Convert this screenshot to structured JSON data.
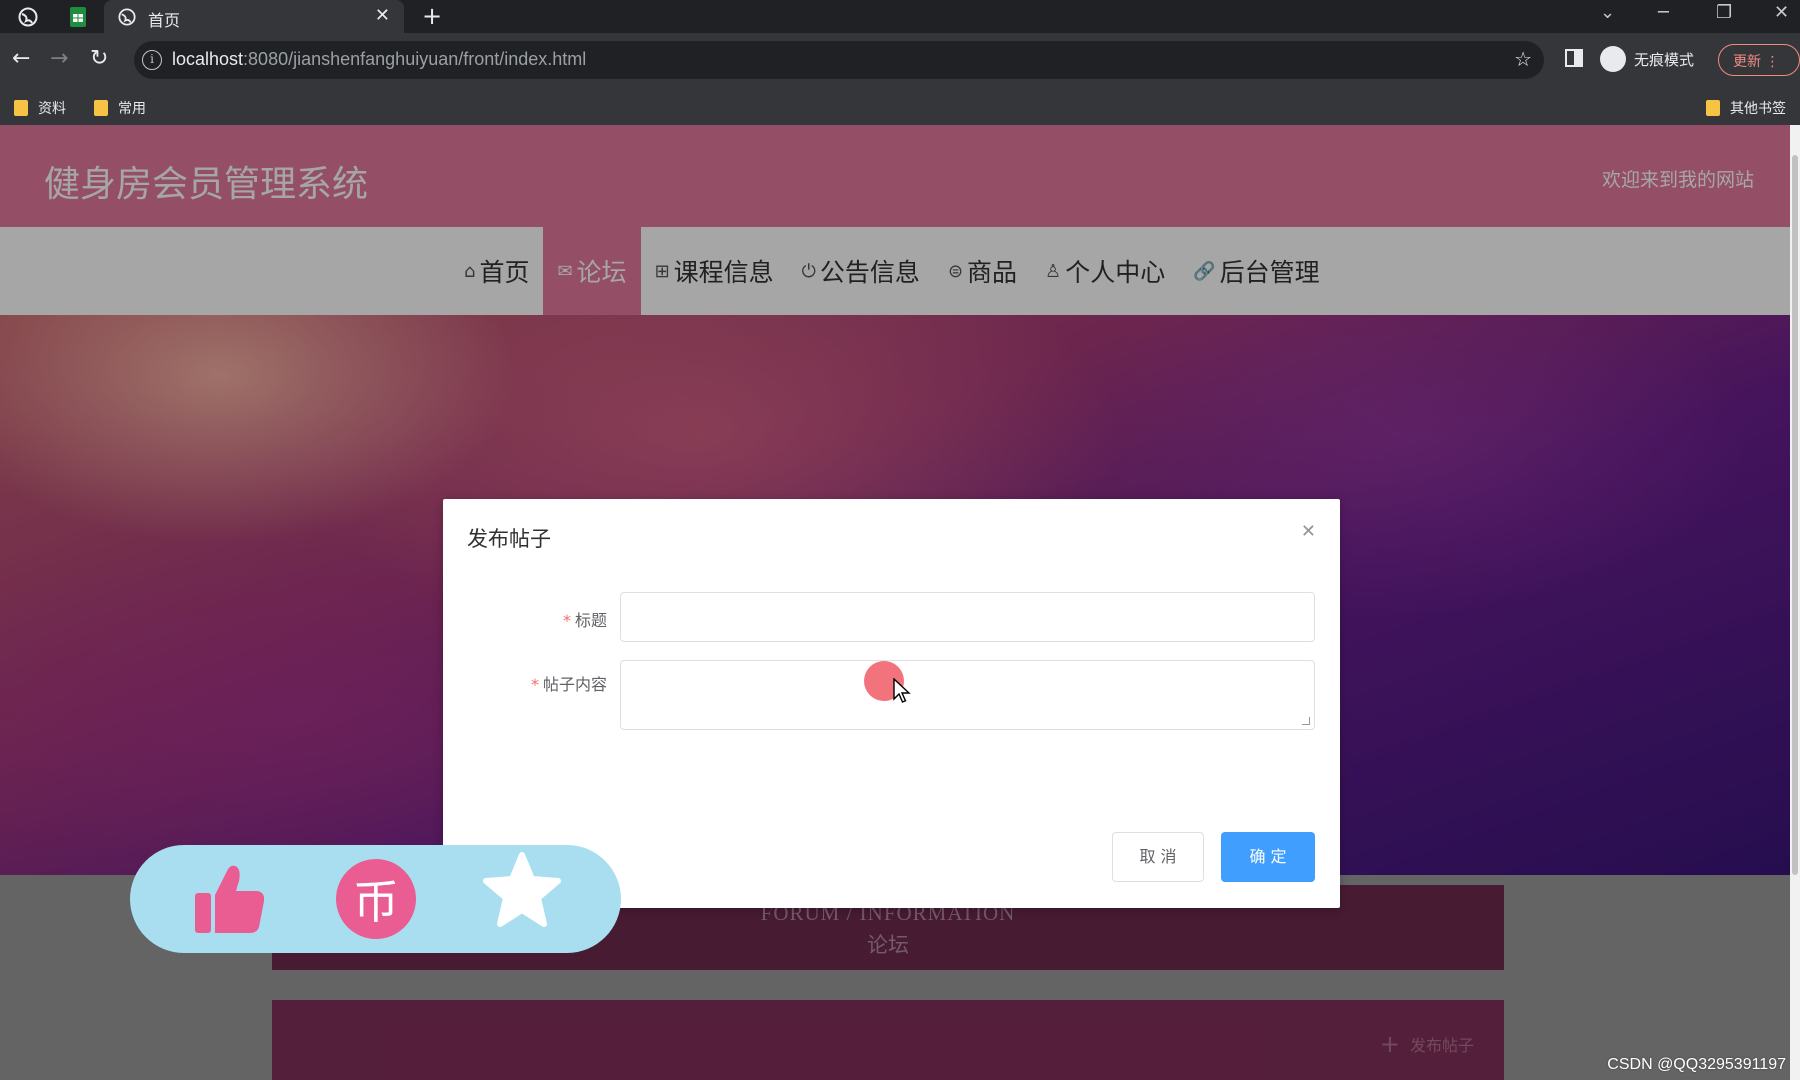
{
  "browser": {
    "tab_title": "首页",
    "url_host": "localhost",
    "url_path": ":8080/jianshenfanghuiyuan/front/index.html",
    "incognito_label": "无痕模式",
    "update_label": "更新",
    "bookmarks": [
      "资料",
      "常用"
    ],
    "other_bookmarks": "其他书签"
  },
  "site": {
    "title": "健身房会员管理系统",
    "welcome": "欢迎来到我的网站"
  },
  "nav": {
    "items": [
      {
        "icon": "⌂",
        "label": "首页",
        "name": "home"
      },
      {
        "icon": "✉",
        "label": "论坛",
        "name": "forum",
        "active": true
      },
      {
        "icon": "⊞",
        "label": "课程信息",
        "name": "courses"
      },
      {
        "icon": "⏻",
        "label": "公告信息",
        "name": "notices"
      },
      {
        "icon": "⊜",
        "label": "商品",
        "name": "goods"
      },
      {
        "icon": "♙",
        "label": "个人中心",
        "name": "profile"
      },
      {
        "icon": "🔗",
        "label": "后台管理",
        "name": "admin"
      }
    ]
  },
  "forum": {
    "heading_en": "FORUM / INFORMATION",
    "heading_cn": "论坛",
    "publish_label": "发布帖子"
  },
  "dialog": {
    "title": "发布帖子",
    "title_label": "标题",
    "title_value": "",
    "content_label": "帖子内容",
    "content_value": "",
    "cancel_label": "取 消",
    "confirm_label": "确 定"
  },
  "icons": {
    "like": "thumbs-up-icon",
    "coin": "coin-icon",
    "favorite": "star-icon",
    "coin_glyph": "币"
  },
  "colors": {
    "header_pink": "#e47a9e",
    "primary_blue": "#409eff",
    "widget_bg": "#a9def0"
  },
  "watermark": "CSDN @QQ3295391197"
}
